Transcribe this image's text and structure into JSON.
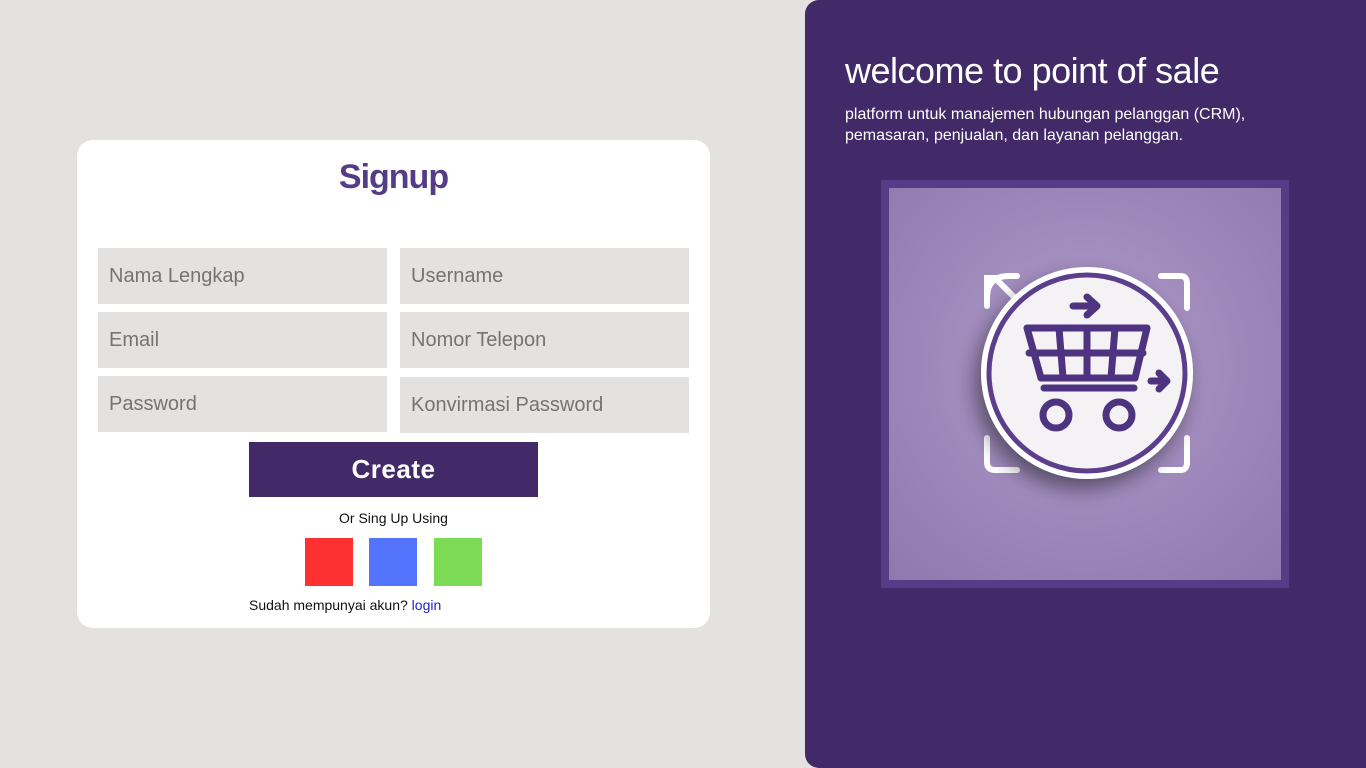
{
  "signup": {
    "title": "Signup",
    "fields": {
      "full_name": {
        "placeholder": "Nama Lengkap",
        "value": ""
      },
      "username": {
        "placeholder": "Username",
        "value": ""
      },
      "email": {
        "placeholder": "Email",
        "value": ""
      },
      "phone": {
        "placeholder": "Nomor Telepon",
        "value": ""
      },
      "password": {
        "placeholder": "Password",
        "value": ""
      },
      "confirm_password": {
        "placeholder": "Konvirmasi Password",
        "value": ""
      }
    },
    "create_label": "Create",
    "or_text": "Or Sing Up Using",
    "social_buttons": [
      {
        "color": "#fe3032"
      },
      {
        "color": "#5474fd"
      },
      {
        "color": "#7edb55"
      }
    ],
    "have_account_text": "Sudah mempunyai akun?",
    "login_link": "login"
  },
  "welcome": {
    "title": "welcome to point of sale",
    "description": "platform untuk manajemen hubungan pelanggan (CRM), pemasaran, penjualan, dan layanan pelanggan.",
    "illustration_icon": "shopping-cart-icon"
  },
  "colors": {
    "brand_purple": "#422a68",
    "title_purple": "#553c86",
    "input_bg": "#e3e2e0",
    "link_blue": "#1f1fd0"
  }
}
